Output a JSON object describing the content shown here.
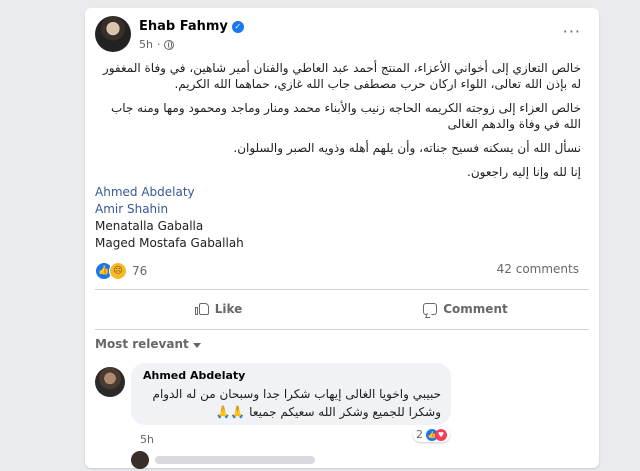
{
  "post": {
    "author": "Ehab Fahmy",
    "time": "5h",
    "paragraphs": [
      "خالص التعازي إلى أخواني  الأعزاء، المنتج أحمد عبد العاطي والفنان أمير شاهين، في وفاة المغفور له بإذن الله تعالى، اللواء اركان حرب مصطفى جاب الله غازي، حماهما الله الكريم.",
      "خالص العزاء إلى زوجته الكريمه الحاجه زنيب والأبناء   محمد ومنار وماجد ومحمود ومها ومنه جاب الله في وفاة والدهم الغالى",
      "نسأل الله أن يسكنه فسيح جناته، وأن يلهم أهله وذويه الصبر والسلوان.",
      "إنا لله وإنا إليه راجعون."
    ],
    "tags": [
      {
        "name": "Ahmed Abdelaty",
        "linked": true
      },
      {
        "name": "Amir Shahin",
        "linked": true
      },
      {
        "name": "Menatalla Gaballa",
        "linked": false
      },
      {
        "name": "Maged Mostafa Gaballah",
        "linked": false
      }
    ],
    "reaction_count": "76",
    "comments_count": "42 comments"
  },
  "actions": {
    "like": "Like",
    "comment": "Comment"
  },
  "sort_label": "Most relevant",
  "comment": {
    "author": "Ahmed Abdelaty",
    "text": "حبيبي واخويا الغالى إيهاب شكرا جدا وسبحان من له الدوام وشكرا للجميع وشكر الله سعيكم جميعا 🙏🙏",
    "time": "5h",
    "reaction_count": "2"
  },
  "colors": {
    "brand": "#1877f2",
    "link": "#385898",
    "background": "#e9ebee"
  },
  "icons": [
    "verified-icon",
    "globe-icon",
    "more-icon",
    "like-reaction-icon",
    "sad-reaction-icon",
    "like-icon",
    "comment-icon",
    "caret-down-icon",
    "love-reaction-icon"
  ]
}
